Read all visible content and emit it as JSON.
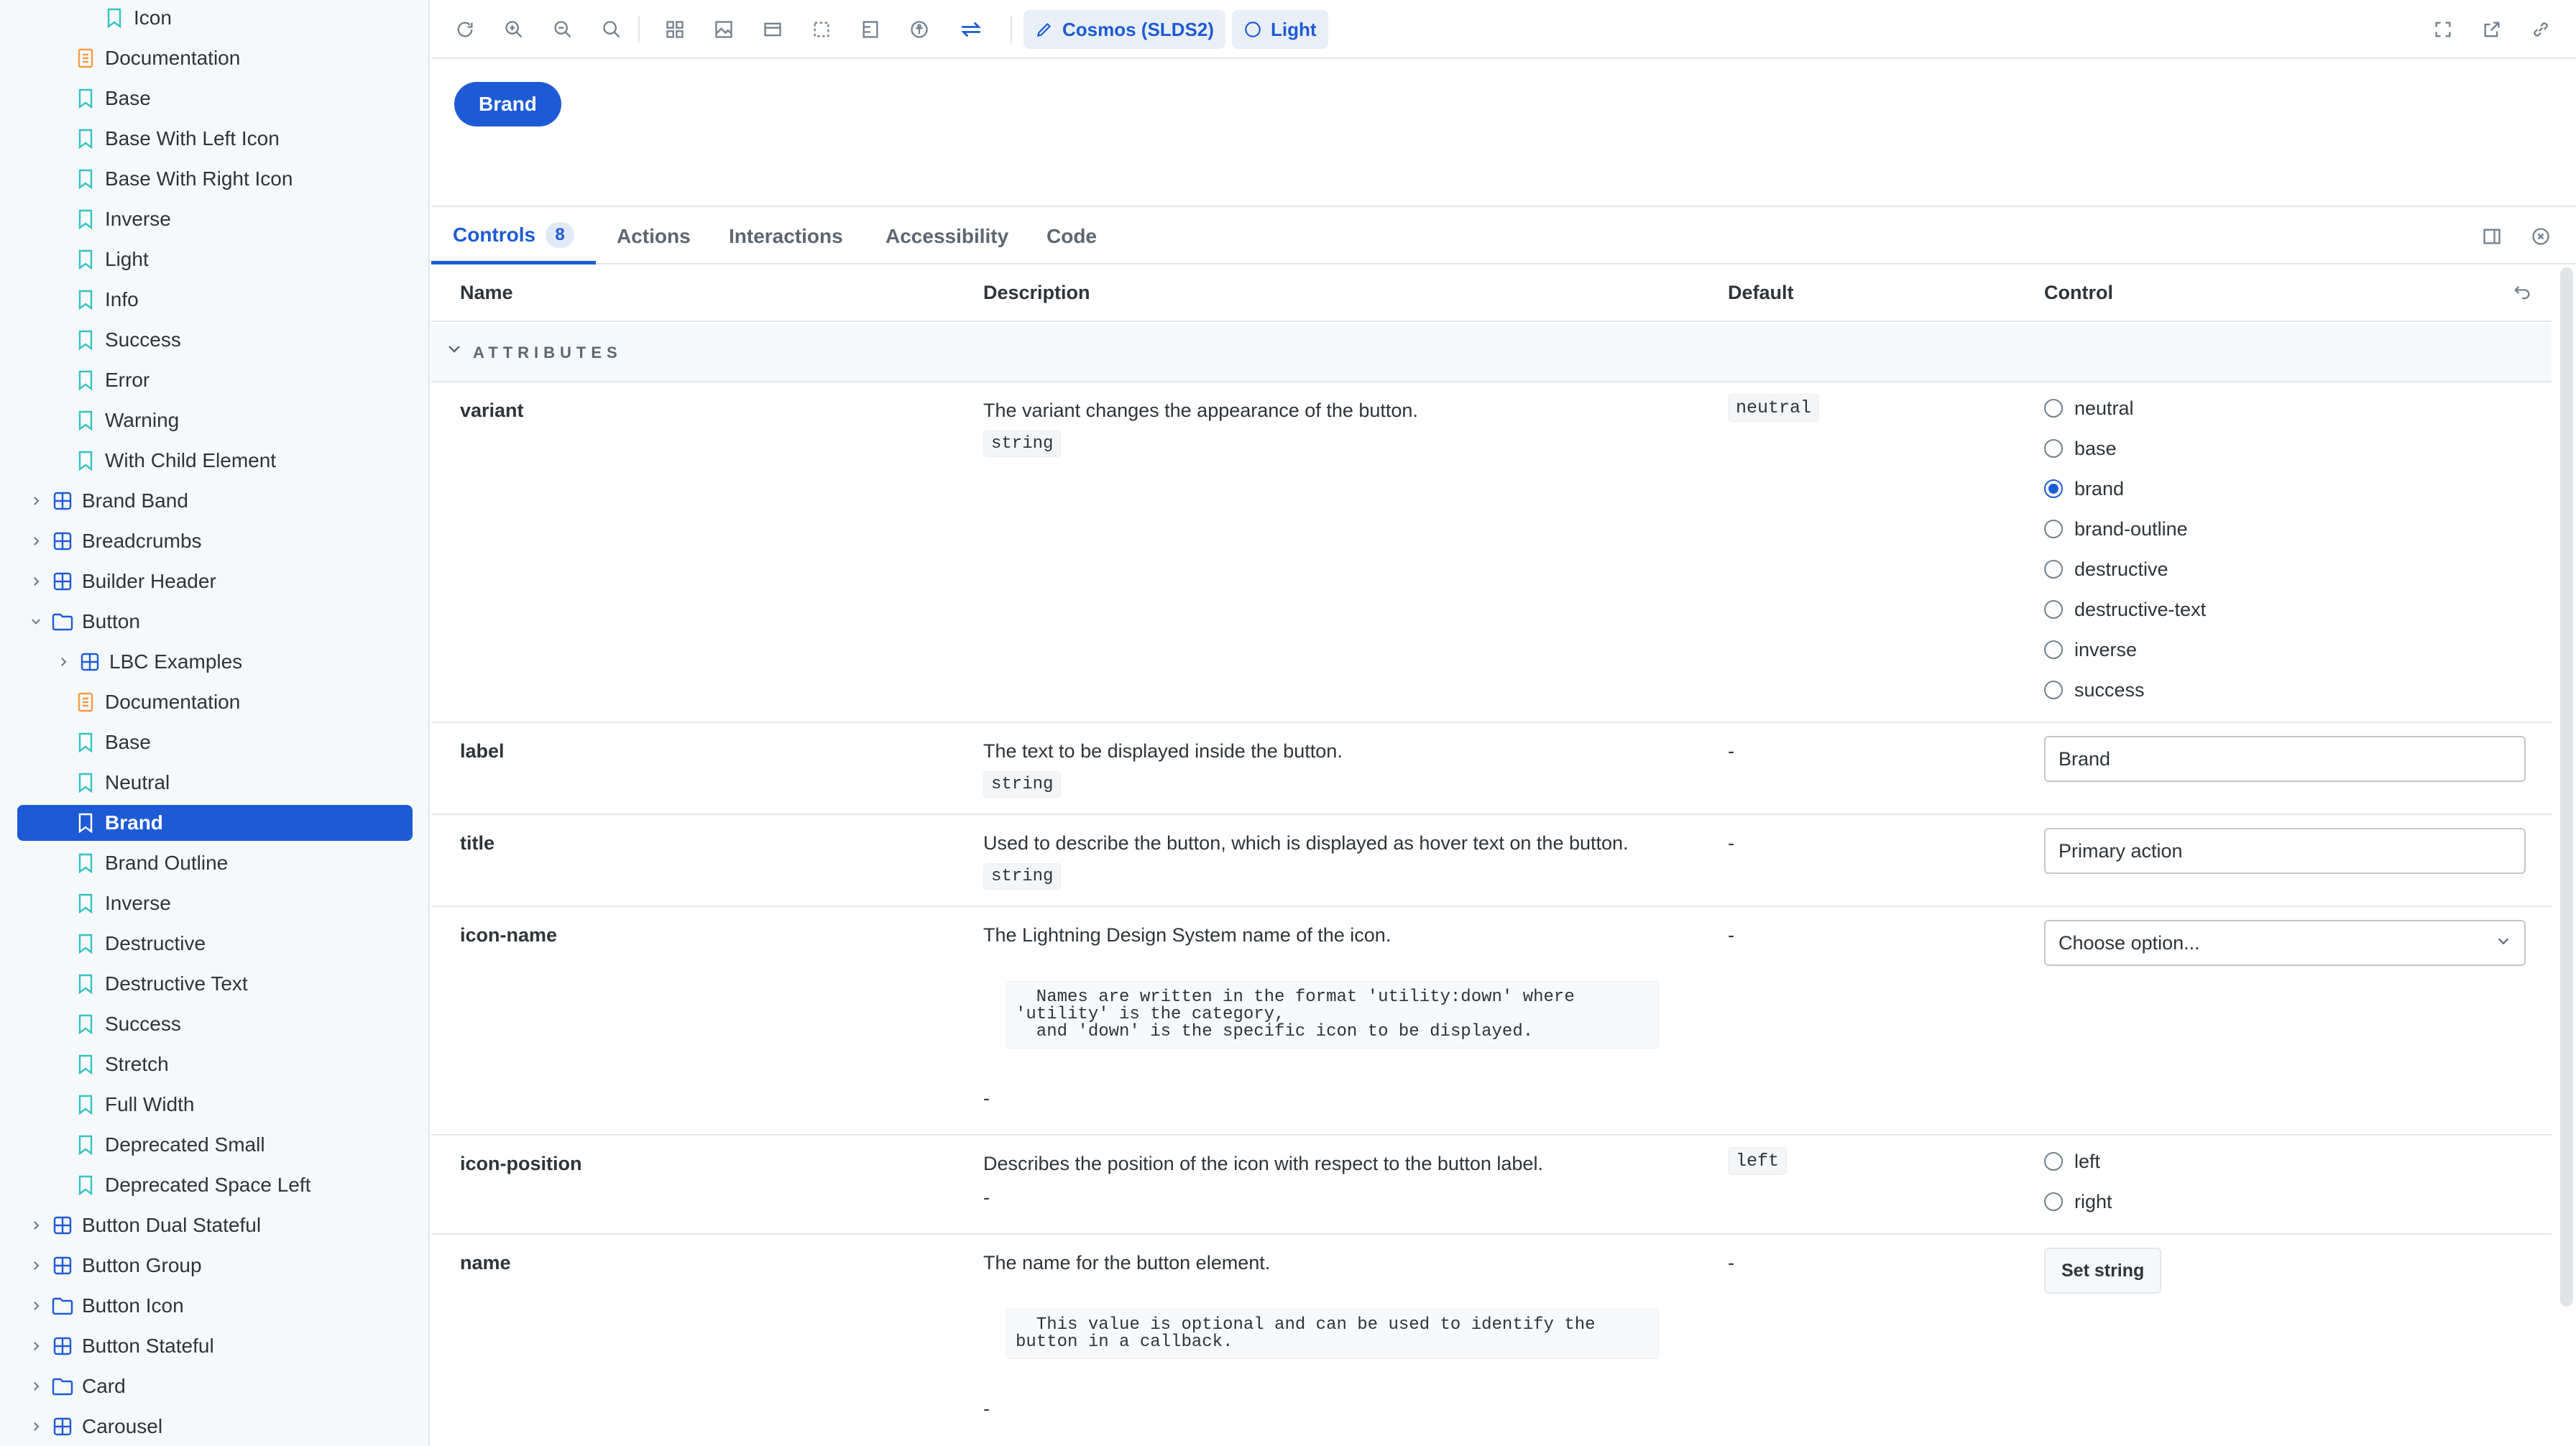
{
  "sidebar": {
    "items": [
      {
        "label": "Icon",
        "kind": "story"
      },
      {
        "label": "Documentation",
        "kind": "doc"
      },
      {
        "label": "Base",
        "kind": "story"
      },
      {
        "label": "Base With Left Icon",
        "kind": "story"
      },
      {
        "label": "Base With Right Icon",
        "kind": "story"
      },
      {
        "label": "Inverse",
        "kind": "story"
      },
      {
        "label": "Light",
        "kind": "story"
      },
      {
        "label": "Info",
        "kind": "story"
      },
      {
        "label": "Success",
        "kind": "story"
      },
      {
        "label": "Error",
        "kind": "story"
      },
      {
        "label": "Warning",
        "kind": "story"
      },
      {
        "label": "With Child Element",
        "kind": "story"
      },
      {
        "label": "Brand Band",
        "kind": "component",
        "expanded": false
      },
      {
        "label": "Breadcrumbs",
        "kind": "component",
        "expanded": false
      },
      {
        "label": "Builder Header",
        "kind": "component",
        "expanded": false
      },
      {
        "label": "Button",
        "kind": "folder",
        "expanded": true
      },
      {
        "label": "LBC Examples",
        "kind": "component",
        "expanded": false
      },
      {
        "label": "Documentation",
        "kind": "doc"
      },
      {
        "label": "Base",
        "kind": "story"
      },
      {
        "label": "Neutral",
        "kind": "story"
      },
      {
        "label": "Brand",
        "kind": "story",
        "selected": true
      },
      {
        "label": "Brand Outline",
        "kind": "story"
      },
      {
        "label": "Inverse",
        "kind": "story"
      },
      {
        "label": "Destructive",
        "kind": "story"
      },
      {
        "label": "Destructive Text",
        "kind": "story"
      },
      {
        "label": "Success",
        "kind": "story"
      },
      {
        "label": "Stretch",
        "kind": "story"
      },
      {
        "label": "Full Width",
        "kind": "story"
      },
      {
        "label": "Deprecated Small",
        "kind": "story"
      },
      {
        "label": "Deprecated Space Left",
        "kind": "story"
      },
      {
        "label": "Button Dual Stateful",
        "kind": "component",
        "expanded": false
      },
      {
        "label": "Button Group",
        "kind": "component",
        "expanded": false
      },
      {
        "label": "Button Icon",
        "kind": "folder",
        "expanded": false
      },
      {
        "label": "Button Stateful",
        "kind": "component",
        "expanded": false
      },
      {
        "label": "Card",
        "kind": "folder",
        "expanded": false
      },
      {
        "label": "Carousel",
        "kind": "component",
        "expanded": false
      }
    ]
  },
  "toolbar": {
    "theme_label": "Cosmos (SLDS2)",
    "mode_label": "Light",
    "icons": [
      "reload-icon",
      "zoom-in-icon",
      "zoom-out-icon",
      "zoom-reset-icon",
      "grid-icon",
      "background-icon",
      "viewport-icon",
      "outline-icon",
      "measure-icon",
      "accessibility-icon",
      "direction-icon",
      "fullscreen-icon",
      "open-new-tab-icon",
      "copy-link-icon"
    ]
  },
  "preview": {
    "button_label": "Brand"
  },
  "tabs": {
    "items": [
      "Controls",
      "Actions",
      "Interactions",
      "Accessibility",
      "Code"
    ],
    "controls_count": "8"
  },
  "table": {
    "headers": {
      "name": "Name",
      "description": "Description",
      "default": "Default",
      "control": "Control"
    },
    "section": "ATTRIBUTES",
    "rows": {
      "variant": {
        "name": "variant",
        "description": "The variant changes the appearance of the button.",
        "type": "string",
        "default": "neutral",
        "options": [
          "neutral",
          "base",
          "brand",
          "brand-outline",
          "destructive",
          "destructive-text",
          "inverse",
          "success"
        ],
        "selected": "brand"
      },
      "label": {
        "name": "label",
        "description": "The text to be displayed inside the button.",
        "type": "string",
        "default": "-",
        "value": "Brand"
      },
      "title": {
        "name": "title",
        "description": "Used to describe the button, which is displayed as hover text on the button.",
        "type": "string",
        "default": "-",
        "value": "Primary action"
      },
      "icon_name": {
        "name": "icon-name",
        "description": "The Lightning Design System name of the icon.",
        "code": "  Names are written in the format 'utility:down' where\n'utility' is the category,\n  and 'down' is the specific icon to be displayed.",
        "trailing": "-",
        "default": "-",
        "placeholder": "Choose option..."
      },
      "icon_position": {
        "name": "icon-position",
        "description": "Describes the position of the icon with respect to the button label.",
        "trailing": "-",
        "default": "left",
        "options": [
          "left",
          "right"
        ]
      },
      "name_attr": {
        "name": "name",
        "description": "The name for the button element.",
        "code": "  This value is optional and can be used to identify the\nbutton in a callback.",
        "trailing": "-",
        "default": "-",
        "button_label": "Set string"
      }
    }
  },
  "colors": {
    "accent": "#1d5bd6",
    "sidebar_bg": "#f6f9fc",
    "story_icon": "#37c2c0",
    "doc_icon": "#f39c44",
    "component_icon": "#1d5bd6"
  }
}
